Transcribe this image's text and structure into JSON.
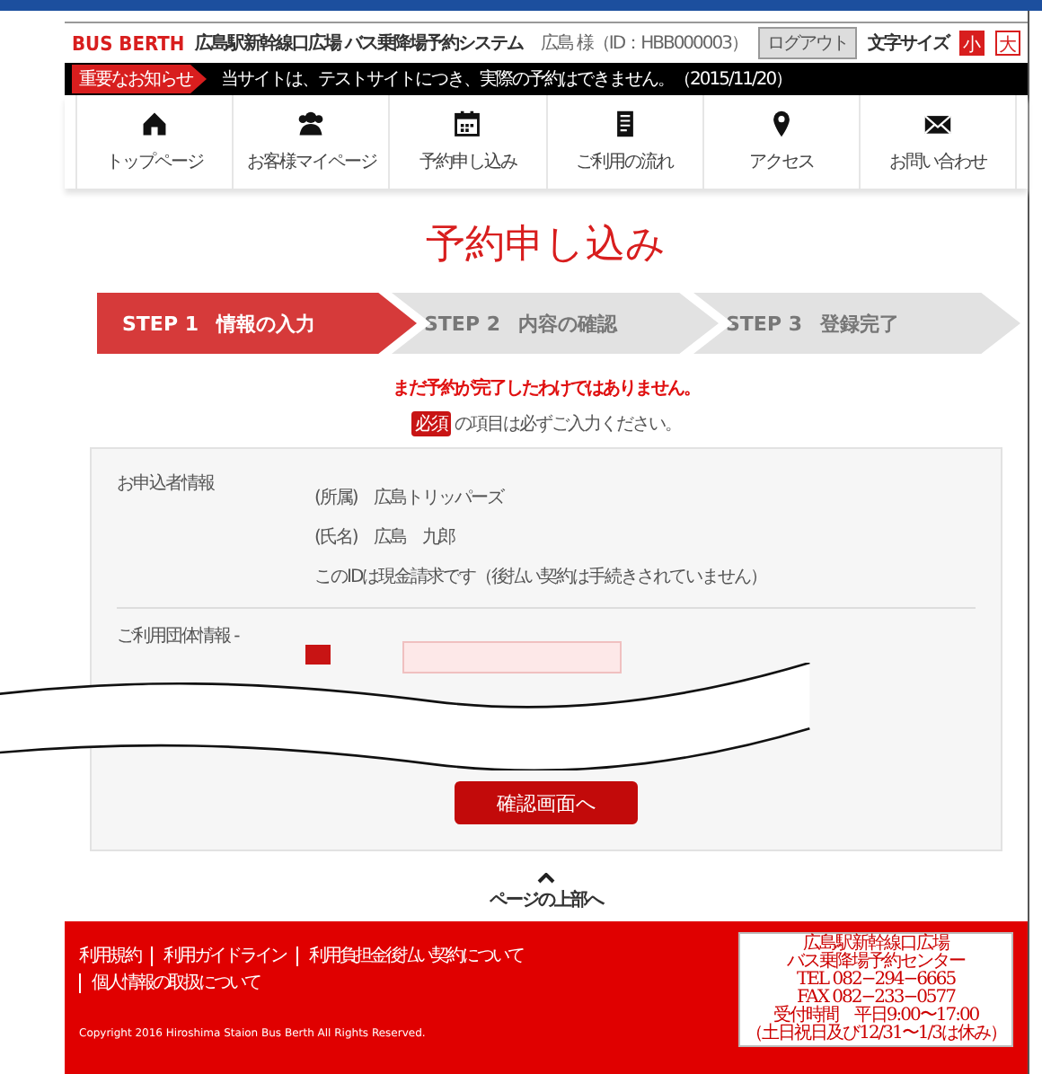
{
  "header": {
    "logo": "BUS BERTH",
    "title": "広島駅新幹線口広場 バス乗降場予約システム",
    "user": "広島 様（ID：HBB000003）",
    "logout": "ログアウト",
    "font_size_label": "文字サイズ",
    "font_sizes": [
      {
        "label": "小",
        "selected": true
      },
      {
        "label": "大",
        "selected": false
      }
    ]
  },
  "notice": {
    "label": "重要なお知らせ",
    "text": "当サイトは、テストサイトにつき、実際の予約はできません。（2015/11/20）"
  },
  "nav": [
    {
      "label": "トップページ"
    },
    {
      "label": "お客様マイページ"
    },
    {
      "label": "予約申し込み"
    },
    {
      "label": "ご利用の流れ"
    },
    {
      "label": "アクセス"
    },
    {
      "label": "お問い合わせ"
    }
  ],
  "page_title": "予約申し込み",
  "steps": [
    {
      "number": "STEP 1",
      "label": "情報の入力",
      "selected": true
    },
    {
      "number": "STEP 2",
      "label": "内容の確認",
      "selected": false
    },
    {
      "number": "STEP 3",
      "label": "登録完了",
      "selected": false
    }
  ],
  "warning": "まだ予約が完了したわけではありません。",
  "required_note": {
    "badge": "必須",
    "text": "の項目は必ずご入力ください。"
  },
  "applicant": {
    "label": "お申込者情報",
    "lines": [
      "(所属)　広島トリッパーズ",
      "(氏名)　広島　九郎",
      "このIDは現金請求です（後払い契約は手続きされていません）"
    ]
  },
  "group": {
    "label": "ご利用団体情報 -"
  },
  "submit": "確認画面へ",
  "page_top": "ページの上部へ",
  "footer": {
    "links": [
      "利用規約",
      "利用ガイドライン",
      "利用負担金後払い契約について",
      "個人情報の取扱について"
    ],
    "contact": [
      "広島駅新幹線口広場",
      "バス乗降場予約センター",
      "TEL 082−294−6665",
      "FAX 082−233−0577",
      "受付時間　平日9:00〜17:00",
      "（土日祝日及び12/31〜1/3は休み）"
    ],
    "copyright": "Copyright 2016 Hiroshima Staion Bus Berth All Rights Reserved."
  }
}
